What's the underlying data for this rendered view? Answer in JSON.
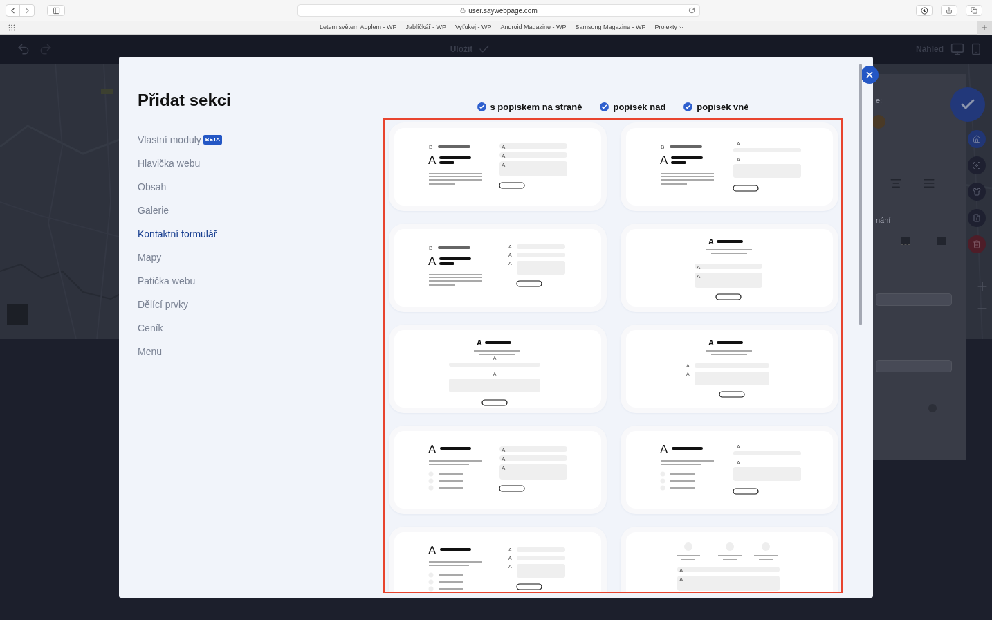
{
  "browser": {
    "address": "user.saywebpage.com",
    "bookmarks": [
      "Letem světem Applem - WP",
      "Jablíčkář - WP",
      "Vyťukej - WP",
      "Android Magazine - WP",
      "Samsung Magazine - WP"
    ],
    "bookmark_folder": "Projekty"
  },
  "toolbar": {
    "save": "Uložit",
    "preview": "Náhled"
  },
  "settings_panel": {
    "labels": [
      "e:",
      "nání"
    ]
  },
  "dialog": {
    "title": "Přidat sekci",
    "categories": [
      {
        "label": "Vlastní moduly",
        "badge": "BETA",
        "selected": false
      },
      {
        "label": "Hlavička webu",
        "selected": false
      },
      {
        "label": "Obsah",
        "selected": false
      },
      {
        "label": "Galerie",
        "selected": false
      },
      {
        "label": "Kontaktní formulář",
        "selected": true
      },
      {
        "label": "Mapy",
        "selected": false
      },
      {
        "label": "Patička webu",
        "selected": false
      },
      {
        "label": "Dělící prvky",
        "selected": false
      },
      {
        "label": "Ceník",
        "selected": false
      },
      {
        "label": "Menu",
        "selected": false
      }
    ],
    "filters": [
      {
        "label": "s popiskem na straně",
        "checked": true
      },
      {
        "label": "popisek nad",
        "checked": true
      },
      {
        "label": "popisek vně",
        "checked": true
      }
    ],
    "layouts": [
      {
        "kind": "side-inside",
        "intro": "B",
        "heading": "A",
        "field_labels": [
          "A",
          "A",
          "A"
        ]
      },
      {
        "kind": "side-above",
        "intro": "B",
        "heading": "A",
        "field_labels": [
          "A",
          "A"
        ]
      },
      {
        "kind": "side-outside",
        "intro": "B",
        "heading": "A",
        "field_labels": [
          "A",
          "A",
          "A"
        ]
      },
      {
        "kind": "center-inside",
        "heading": "A",
        "field_labels": [
          "A",
          "A"
        ]
      },
      {
        "kind": "center-above",
        "heading": "A",
        "field_labels": [
          "A",
          "A"
        ]
      },
      {
        "kind": "center-outside",
        "heading": "A",
        "field_labels": [
          "A",
          "A"
        ]
      },
      {
        "kind": "list-inside",
        "heading": "A",
        "field_labels": [
          "A",
          "A",
          "A"
        ]
      },
      {
        "kind": "list-above",
        "heading": "A",
        "field_labels": [
          "A",
          "A"
        ]
      },
      {
        "kind": "list-outside",
        "heading": "A",
        "field_labels": [
          "A",
          "A",
          "A"
        ]
      },
      {
        "kind": "icons-inside",
        "field_labels": [
          "A",
          "A"
        ]
      }
    ]
  }
}
